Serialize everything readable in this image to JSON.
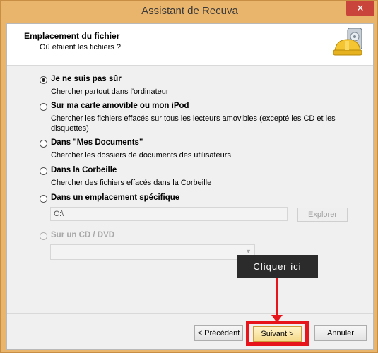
{
  "window": {
    "title": "Assistant de Recuva",
    "close_glyph": "✕"
  },
  "header": {
    "title": "Emplacement du fichier",
    "subtitle": "Où étaient les fichiers ?",
    "logo_icon": "recuva-helmet-drive-icon"
  },
  "options": [
    {
      "label": "Je ne suis pas sûr",
      "description": "Chercher partout dans l'ordinateur",
      "selected": true,
      "enabled": true
    },
    {
      "label": "Sur ma carte amovible ou mon iPod",
      "description": "Chercher les fichiers effacés sur tous les lecteurs amovibles (excepté les CD et les disquettes)",
      "selected": false,
      "enabled": true
    },
    {
      "label": "Dans \"Mes Documents\"",
      "description": "Chercher les dossiers de documents des utilisateurs",
      "selected": false,
      "enabled": true
    },
    {
      "label": "Dans la Corbeille",
      "description": "Chercher des fichiers effacés dans la Corbeille",
      "selected": false,
      "enabled": true
    },
    {
      "label": "Dans un emplacement spécifique",
      "description": "",
      "selected": false,
      "enabled": true
    },
    {
      "label": "Sur un CD / DVD",
      "description": "",
      "selected": false,
      "enabled": false
    }
  ],
  "specific_location": {
    "path_value": "C:\\",
    "browse_label": "Explorer"
  },
  "cd_dvd": {
    "selected_value": ""
  },
  "buttons": {
    "previous": "< Précédent",
    "next": "Suivant >",
    "cancel": "Annuler"
  },
  "annotation": {
    "callout_text": "Cliquer ici",
    "highlight_color": "#e8141b"
  }
}
